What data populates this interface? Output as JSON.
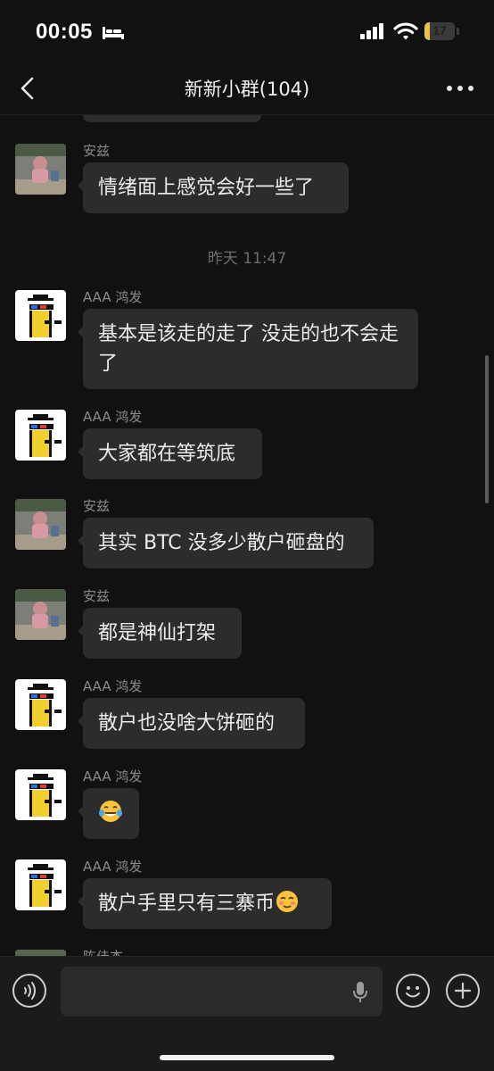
{
  "status_bar": {
    "time": "00:05",
    "battery": "17",
    "battery_level": 0.17
  },
  "header": {
    "title": "新新小群(104)"
  },
  "messages": [
    {
      "sender": "安兹",
      "text": "情绪面上感觉会好一些了",
      "avatar": "photo-avatar"
    },
    {
      "timestamp": "昨天 11:47"
    },
    {
      "sender": "AAA 鸿发",
      "text": "基本是该走的走了 没走的也不会走了",
      "avatar": "pixel-avatar"
    },
    {
      "sender": "AAA 鸿发",
      "text": "大家都在等筑底",
      "avatar": "pixel-avatar"
    },
    {
      "sender": "安兹",
      "text": "其实 BTC 没多少散户砸盘的",
      "avatar": "photo-avatar"
    },
    {
      "sender": "安兹",
      "text": "都是神仙打架",
      "avatar": "photo-avatar"
    },
    {
      "sender": "AAA 鸿发",
      "text": "散户也没啥大饼砸的",
      "avatar": "pixel-avatar"
    },
    {
      "sender": "AAA 鸿发",
      "text": "",
      "emoji": "tears-of-joy-emoji",
      "avatar": "pixel-avatar"
    },
    {
      "sender": "AAA 鸿发",
      "text": "散户手里只有三寨币",
      "emoji": "flushed-smile-emoji",
      "avatar": "pixel-avatar"
    },
    {
      "sender": "陈佳杰",
      "text": "",
      "avatar": "photo-avatar"
    }
  ],
  "colors": {
    "background": "#111111",
    "bubble": "#2c2c2c",
    "meta_text": "#8a8a8a",
    "battery": "#e8c24a"
  }
}
